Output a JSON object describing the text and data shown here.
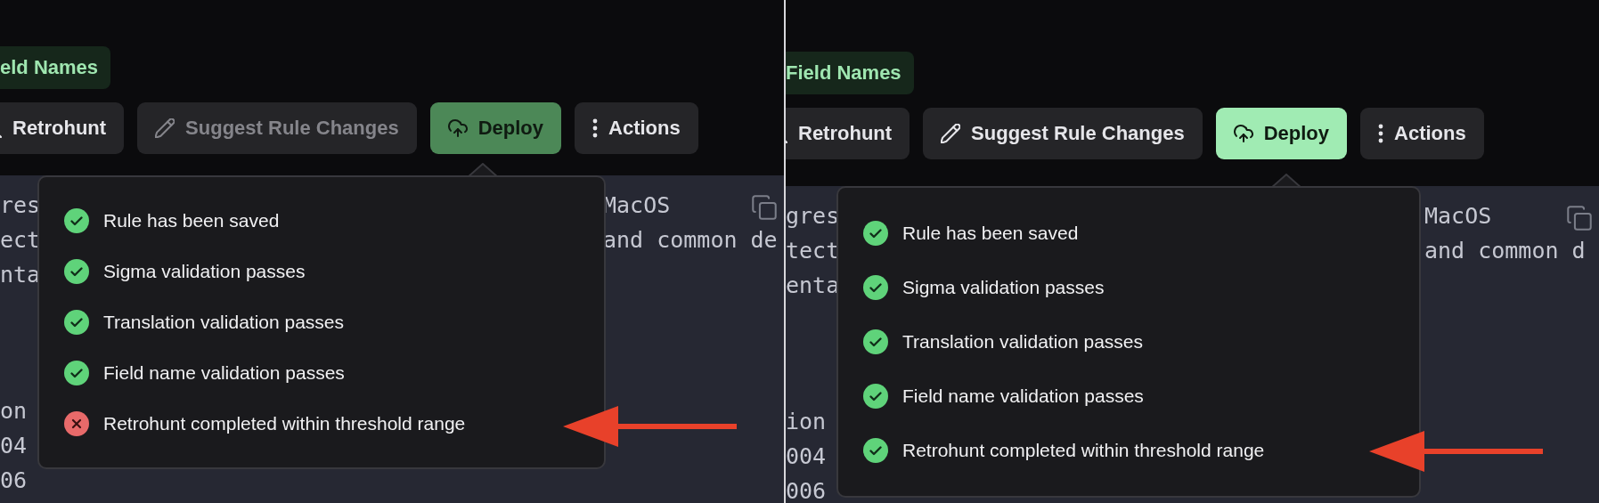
{
  "panels": [
    {
      "badge": "eld Names",
      "buttons": [
        {
          "kind": "search",
          "label": "Retrohunt",
          "disabled": false
        },
        {
          "kind": "edit",
          "label": "Suggest Rule Changes",
          "disabled": true
        },
        {
          "kind": "deploy",
          "label": "Deploy",
          "disabled": true
        },
        {
          "kind": "menu",
          "label": "Actions",
          "disabled": false
        }
      ],
      "code_blocks": [
        [
          {
            "start": "res",
            "end": "MacOS"
          },
          {
            "start": "ect",
            "end": "and common de"
          },
          {
            "start": "nta"
          }
        ],
        [
          {
            "start": "on"
          },
          {
            "start": "04"
          },
          {
            "start": "06"
          }
        ]
      ],
      "checklist": [
        {
          "label": "Rule has been saved",
          "passed": true
        },
        {
          "label": "Sigma validation passes",
          "passed": true
        },
        {
          "label": "Translation validation passes",
          "passed": true
        },
        {
          "label": "Field name validation passes",
          "passed": true
        },
        {
          "label": "Retrohunt completed within threshold range",
          "passed": false
        }
      ]
    },
    {
      "badge": "Field Names",
      "buttons": [
        {
          "kind": "search",
          "label": "Retrohunt",
          "disabled": false
        },
        {
          "kind": "edit",
          "label": "Suggest Rule Changes",
          "disabled": false
        },
        {
          "kind": "deploy",
          "label": "Deploy",
          "disabled": false
        },
        {
          "kind": "menu",
          "label": "Actions",
          "disabled": false
        }
      ],
      "code_blocks": [
        [
          {
            "start": "gres",
            "end": "MacOS"
          },
          {
            "start": "tect",
            "end": "and common d"
          },
          {
            "start": "enta"
          }
        ],
        [
          {
            "start": "ion"
          },
          {
            "start": "004"
          },
          {
            "start": "006"
          }
        ]
      ],
      "checklist": [
        {
          "label": "Rule has been saved",
          "passed": true
        },
        {
          "label": "Sigma validation passes",
          "passed": true
        },
        {
          "label": "Translation validation passes",
          "passed": true
        },
        {
          "label": "Field name validation passes",
          "passed": true
        },
        {
          "label": "Retrohunt completed within threshold range",
          "passed": true
        }
      ]
    }
  ]
}
